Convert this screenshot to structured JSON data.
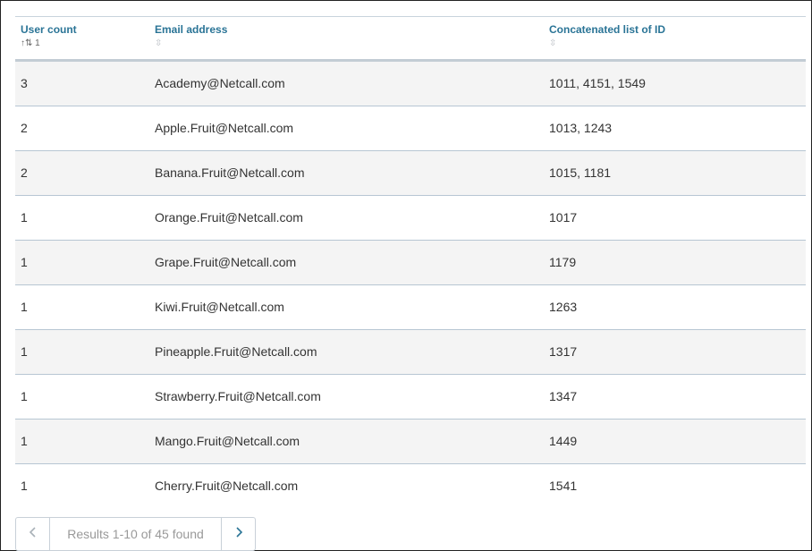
{
  "table": {
    "columns": [
      {
        "label": "User count",
        "sort_indicator": "↑⇅ 1"
      },
      {
        "label": "Email address",
        "sort_indicator": "⇳"
      },
      {
        "label": "Concatenated list of ID",
        "sort_indicator": "⇳"
      }
    ],
    "rows": [
      {
        "count": "3",
        "email": "Academy@Netcall.com",
        "ids": "1011, 4151, 1549"
      },
      {
        "count": "2",
        "email": "Apple.Fruit@Netcall.com",
        "ids": "1013, 1243"
      },
      {
        "count": "2",
        "email": "Banana.Fruit@Netcall.com",
        "ids": "1015, 1181"
      },
      {
        "count": "1",
        "email": "Orange.Fruit@Netcall.com",
        "ids": "1017"
      },
      {
        "count": "1",
        "email": "Grape.Fruit@Netcall.com",
        "ids": "1179"
      },
      {
        "count": "1",
        "email": "Kiwi.Fruit@Netcall.com",
        "ids": "1263"
      },
      {
        "count": "1",
        "email": "Pineapple.Fruit@Netcall.com",
        "ids": "1317"
      },
      {
        "count": "1",
        "email": "Strawberry.Fruit@Netcall.com",
        "ids": "1347"
      },
      {
        "count": "1",
        "email": "Mango.Fruit@Netcall.com",
        "ids": "1449"
      },
      {
        "count": "1",
        "email": "Cherry.Fruit@Netcall.com",
        "ids": "1541"
      }
    ]
  },
  "pagination": {
    "prev_icon": "chevron-left-icon",
    "next_icon": "chevron-right-icon",
    "status": "Results 1-10 of 45 found"
  },
  "colors": {
    "header_text": "#2a7496",
    "row_alt": "#f4f4f4",
    "row_border": "#b7c6d3"
  }
}
